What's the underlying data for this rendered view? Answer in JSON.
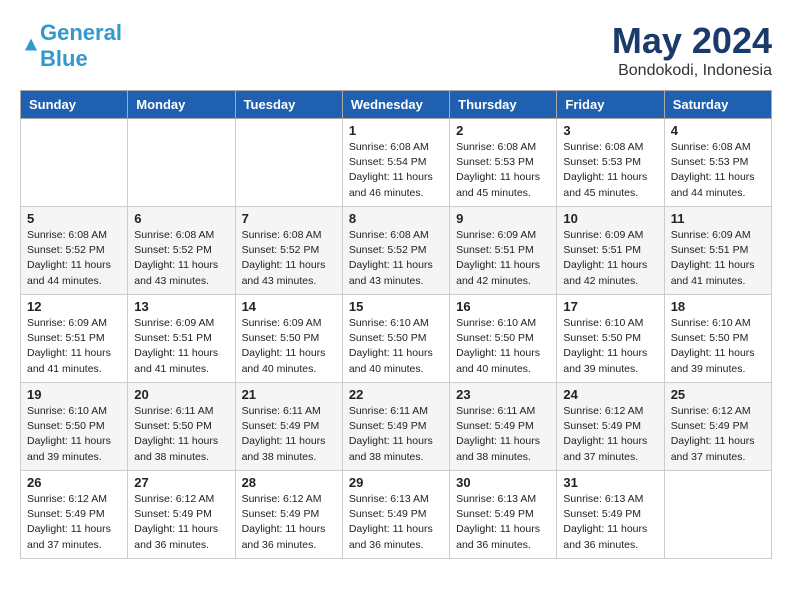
{
  "logo": {
    "text_general": "General",
    "text_blue": "Blue"
  },
  "title": "May 2024",
  "location": "Bondokodi, Indonesia",
  "days_of_week": [
    "Sunday",
    "Monday",
    "Tuesday",
    "Wednesday",
    "Thursday",
    "Friday",
    "Saturday"
  ],
  "weeks": [
    [
      {
        "day": "",
        "info": ""
      },
      {
        "day": "",
        "info": ""
      },
      {
        "day": "",
        "info": ""
      },
      {
        "day": "1",
        "info": "Sunrise: 6:08 AM\nSunset: 5:54 PM\nDaylight: 11 hours\nand 46 minutes."
      },
      {
        "day": "2",
        "info": "Sunrise: 6:08 AM\nSunset: 5:53 PM\nDaylight: 11 hours\nand 45 minutes."
      },
      {
        "day": "3",
        "info": "Sunrise: 6:08 AM\nSunset: 5:53 PM\nDaylight: 11 hours\nand 45 minutes."
      },
      {
        "day": "4",
        "info": "Sunrise: 6:08 AM\nSunset: 5:53 PM\nDaylight: 11 hours\nand 44 minutes."
      }
    ],
    [
      {
        "day": "5",
        "info": "Sunrise: 6:08 AM\nSunset: 5:52 PM\nDaylight: 11 hours\nand 44 minutes."
      },
      {
        "day": "6",
        "info": "Sunrise: 6:08 AM\nSunset: 5:52 PM\nDaylight: 11 hours\nand 43 minutes."
      },
      {
        "day": "7",
        "info": "Sunrise: 6:08 AM\nSunset: 5:52 PM\nDaylight: 11 hours\nand 43 minutes."
      },
      {
        "day": "8",
        "info": "Sunrise: 6:08 AM\nSunset: 5:52 PM\nDaylight: 11 hours\nand 43 minutes."
      },
      {
        "day": "9",
        "info": "Sunrise: 6:09 AM\nSunset: 5:51 PM\nDaylight: 11 hours\nand 42 minutes."
      },
      {
        "day": "10",
        "info": "Sunrise: 6:09 AM\nSunset: 5:51 PM\nDaylight: 11 hours\nand 42 minutes."
      },
      {
        "day": "11",
        "info": "Sunrise: 6:09 AM\nSunset: 5:51 PM\nDaylight: 11 hours\nand 41 minutes."
      }
    ],
    [
      {
        "day": "12",
        "info": "Sunrise: 6:09 AM\nSunset: 5:51 PM\nDaylight: 11 hours\nand 41 minutes."
      },
      {
        "day": "13",
        "info": "Sunrise: 6:09 AM\nSunset: 5:51 PM\nDaylight: 11 hours\nand 41 minutes."
      },
      {
        "day": "14",
        "info": "Sunrise: 6:09 AM\nSunset: 5:50 PM\nDaylight: 11 hours\nand 40 minutes."
      },
      {
        "day": "15",
        "info": "Sunrise: 6:10 AM\nSunset: 5:50 PM\nDaylight: 11 hours\nand 40 minutes."
      },
      {
        "day": "16",
        "info": "Sunrise: 6:10 AM\nSunset: 5:50 PM\nDaylight: 11 hours\nand 40 minutes."
      },
      {
        "day": "17",
        "info": "Sunrise: 6:10 AM\nSunset: 5:50 PM\nDaylight: 11 hours\nand 39 minutes."
      },
      {
        "day": "18",
        "info": "Sunrise: 6:10 AM\nSunset: 5:50 PM\nDaylight: 11 hours\nand 39 minutes."
      }
    ],
    [
      {
        "day": "19",
        "info": "Sunrise: 6:10 AM\nSunset: 5:50 PM\nDaylight: 11 hours\nand 39 minutes."
      },
      {
        "day": "20",
        "info": "Sunrise: 6:11 AM\nSunset: 5:50 PM\nDaylight: 11 hours\nand 38 minutes."
      },
      {
        "day": "21",
        "info": "Sunrise: 6:11 AM\nSunset: 5:49 PM\nDaylight: 11 hours\nand 38 minutes."
      },
      {
        "day": "22",
        "info": "Sunrise: 6:11 AM\nSunset: 5:49 PM\nDaylight: 11 hours\nand 38 minutes."
      },
      {
        "day": "23",
        "info": "Sunrise: 6:11 AM\nSunset: 5:49 PM\nDaylight: 11 hours\nand 38 minutes."
      },
      {
        "day": "24",
        "info": "Sunrise: 6:12 AM\nSunset: 5:49 PM\nDaylight: 11 hours\nand 37 minutes."
      },
      {
        "day": "25",
        "info": "Sunrise: 6:12 AM\nSunset: 5:49 PM\nDaylight: 11 hours\nand 37 minutes."
      }
    ],
    [
      {
        "day": "26",
        "info": "Sunrise: 6:12 AM\nSunset: 5:49 PM\nDaylight: 11 hours\nand 37 minutes."
      },
      {
        "day": "27",
        "info": "Sunrise: 6:12 AM\nSunset: 5:49 PM\nDaylight: 11 hours\nand 36 minutes."
      },
      {
        "day": "28",
        "info": "Sunrise: 6:12 AM\nSunset: 5:49 PM\nDaylight: 11 hours\nand 36 minutes."
      },
      {
        "day": "29",
        "info": "Sunrise: 6:13 AM\nSunset: 5:49 PM\nDaylight: 11 hours\nand 36 minutes."
      },
      {
        "day": "30",
        "info": "Sunrise: 6:13 AM\nSunset: 5:49 PM\nDaylight: 11 hours\nand 36 minutes."
      },
      {
        "day": "31",
        "info": "Sunrise: 6:13 AM\nSunset: 5:49 PM\nDaylight: 11 hours\nand 36 minutes."
      },
      {
        "day": "",
        "info": ""
      }
    ]
  ]
}
